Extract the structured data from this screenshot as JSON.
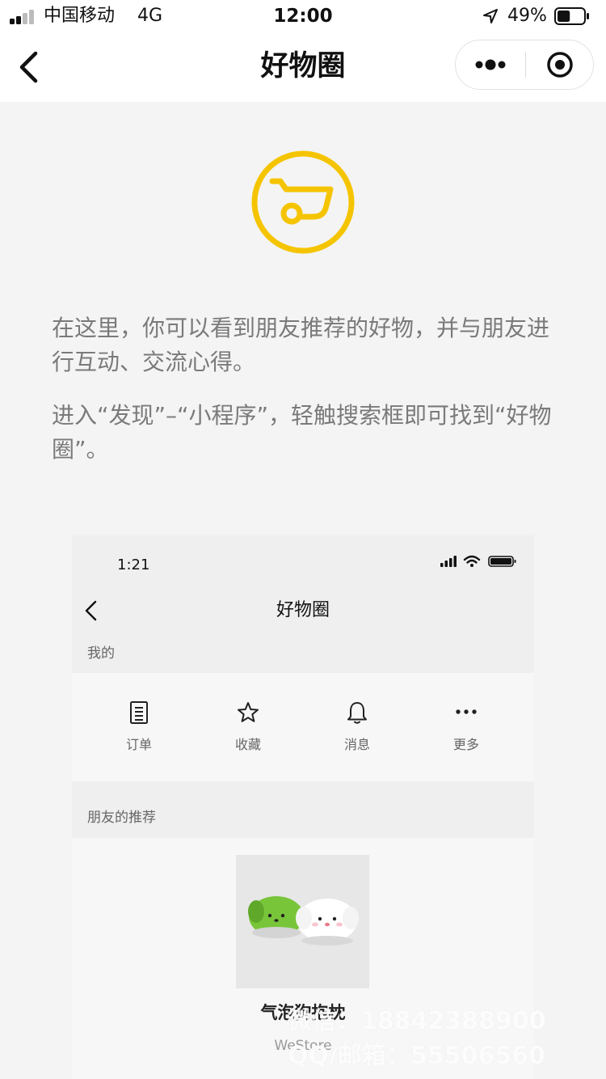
{
  "status_bar": {
    "carrier": "中国移动",
    "network": "4G",
    "time": "12:00",
    "battery_percent": "49%",
    "battery_level": 0.49,
    "signal_bars": 2,
    "icons": [
      "signal-icon",
      "location-arrow-icon",
      "battery-icon"
    ]
  },
  "nav": {
    "title": "好物圈",
    "back_icon": "chevron-left-icon",
    "more_icon": "more-dots-icon",
    "close_icon": "target-close-icon"
  },
  "logo": {
    "icon": "shopping-cart-circle-icon",
    "color": "#F5C400"
  },
  "intro": {
    "paragraph1": "在这里，你可以看到朋友推荐的好物，并与朋友进行互动、交流心得。",
    "paragraph2": "进入“发现”–“小程序”，轻触搜索框即可找到“好物圈”。"
  },
  "preview": {
    "time": "1:21",
    "title": "好物圈",
    "mine_label": "我的",
    "mine_items": [
      {
        "label": "订单",
        "icon": "order-list-icon"
      },
      {
        "label": "收藏",
        "icon": "star-icon"
      },
      {
        "label": "消息",
        "icon": "bell-icon"
      },
      {
        "label": "更多",
        "icon": "more-dots-icon"
      }
    ],
    "friends_label": "朋友的推荐",
    "product": {
      "name": "气泡狗抱枕",
      "store": "WeStore",
      "image": "bubble-dog-plush-image"
    }
  },
  "watermark": {
    "line1": "微信：18842388900",
    "line2": "QQ/邮箱：55506560"
  },
  "colors": {
    "accent": "#F5C400",
    "page_background": "#F4F4F4",
    "body_text": "#7A7A7A"
  }
}
